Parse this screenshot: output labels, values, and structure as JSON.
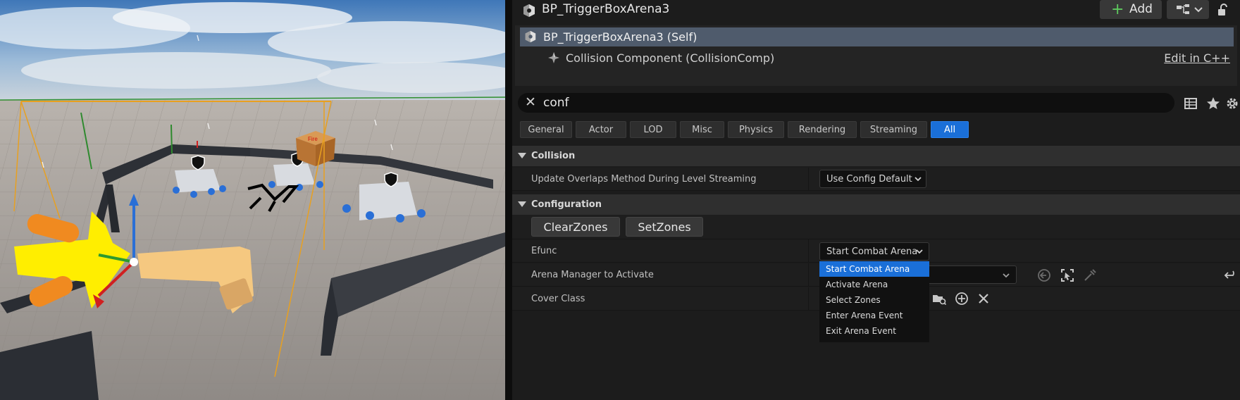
{
  "window": {
    "title": "BP_TriggerBoxArena3"
  },
  "toolbar": {
    "add_label": "Add"
  },
  "components": {
    "self_label": "BP_TriggerBoxArena3 (Self)",
    "collision_label": "Collision Component (CollisionComp)",
    "edit_link": "Edit in C++"
  },
  "search": {
    "value": "conf"
  },
  "filters": [
    "General",
    "Actor",
    "LOD",
    "Misc",
    "Physics",
    "Rendering",
    "Streaming",
    "All"
  ],
  "active_filter": "All",
  "collision": {
    "header": "Collision",
    "update_overlaps_label": "Update Overlaps Method During Level Streaming",
    "update_overlaps_value": "Use Config Default"
  },
  "configuration": {
    "header": "Configuration",
    "clear_zones": "ClearZones",
    "set_zones": "SetZones",
    "efunc_label": "Efunc",
    "efunc_value": "Start Combat Arena",
    "arena_manager_label": "Arena Manager to Activate",
    "cover_class_label": "Cover Class"
  },
  "efunc_dropdown": {
    "options": [
      "Start Combat Arena",
      "Activate Arena",
      "Select Zones",
      "Enter Arena Event",
      "Exit Arena Event"
    ],
    "selected": "Start Combat Arena"
  },
  "viewport": {
    "crate_text": "Fire"
  },
  "colors": {
    "accent": "#1a6fd8",
    "selected_row": "#4f5b6c",
    "add_icon": "#5ec95e"
  }
}
